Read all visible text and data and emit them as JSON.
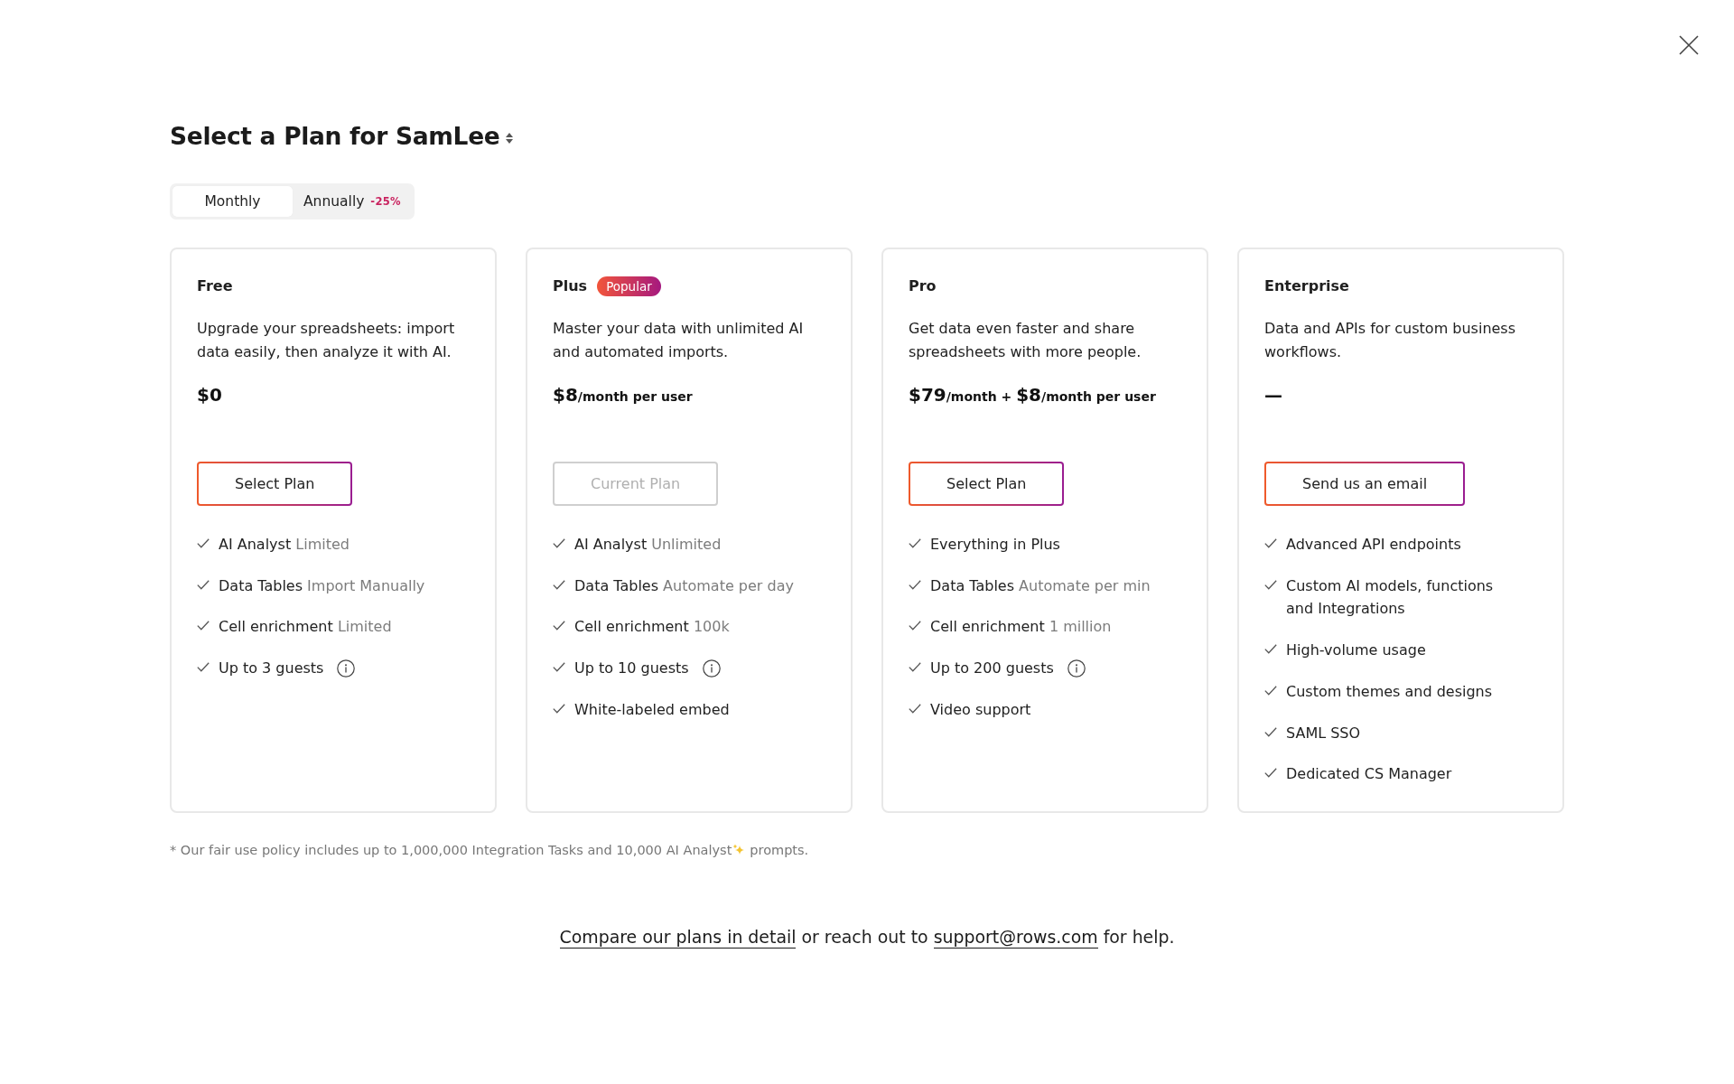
{
  "title": "Select a Plan for SamLee",
  "billing_period": [
    {
      "label": "Monthly",
      "selected": true
    },
    {
      "label": "Annually",
      "selected": false,
      "discount": "-25%"
    }
  ],
  "plans": [
    {
      "name": "Free",
      "description": "Upgrade your spreadsheets: import data easily, then analyze it with AI.",
      "price": [
        {
          "kind": "amount",
          "text": "$0"
        }
      ],
      "button": {
        "label": "Select Plan",
        "disabled": false
      },
      "features": [
        {
          "label": "AI Analyst",
          "detail": "Limited",
          "info": false
        },
        {
          "label": "Data Tables",
          "detail": "Import Manually",
          "info": false
        },
        {
          "label": "Cell enrichment",
          "detail": "Limited",
          "info": false
        },
        {
          "label": "Up to 3 guests",
          "info": true
        }
      ]
    },
    {
      "name": "Plus",
      "badge": "Popular",
      "description": "Master your data with unlimited AI and automated imports.",
      "price": [
        {
          "kind": "amount",
          "text": "$8"
        },
        {
          "kind": "unit",
          "text": "/month per user"
        }
      ],
      "button": {
        "label": "Current Plan",
        "disabled": true
      },
      "features": [
        {
          "label": "AI Analyst",
          "detail": "Unlimited",
          "info": false
        },
        {
          "label": "Data Tables",
          "detail": "Automate per day",
          "info": false
        },
        {
          "label": "Cell enrichment",
          "detail": "100k",
          "info": false
        },
        {
          "label": "Up to 10 guests",
          "info": true
        },
        {
          "label": "White-labeled embed",
          "info": false
        }
      ]
    },
    {
      "name": "Pro",
      "description": "Get data even faster and share spreadsheets with more people.",
      "price": [
        {
          "kind": "amount",
          "text": "$79"
        },
        {
          "kind": "unit",
          "text": "/month + "
        },
        {
          "kind": "amount",
          "text": "$8"
        },
        {
          "kind": "unit",
          "text": "/month per user"
        }
      ],
      "button": {
        "label": "Select Plan",
        "disabled": false
      },
      "features": [
        {
          "label": "Everything in Plus",
          "info": false
        },
        {
          "label": "Data Tables",
          "detail": "Automate per min",
          "info": false
        },
        {
          "label": "Cell enrichment",
          "detail": "1 million",
          "info": false
        },
        {
          "label": "Up to 200 guests",
          "info": true
        },
        {
          "label": "Video support",
          "info": false
        }
      ]
    },
    {
      "name": "Enterprise",
      "description": "Data and APIs for custom business workflows.",
      "price": [
        {
          "kind": "amount",
          "text": "—"
        }
      ],
      "button": {
        "label": "Send us an email",
        "disabled": false
      },
      "features": [
        {
          "label": "Advanced API endpoints",
          "info": false
        },
        {
          "label": "Custom AI models, functions and Integrations",
          "info": false
        },
        {
          "label": "High-volume usage",
          "info": false
        },
        {
          "label": "Custom themes and designs",
          "info": false
        },
        {
          "label": "SAML SSO",
          "info": false
        },
        {
          "label": "Dedicated CS Manager",
          "info": false
        }
      ]
    }
  ],
  "footnote": {
    "text": "* Our fair use policy includes up to 1,000,000 Integration Tasks and 10,000 AI Analyst",
    "after_icon": "prompts."
  },
  "help": [
    {
      "kind": "link",
      "text": "Compare our plans in detail"
    },
    {
      "kind": "text",
      "text": "or reach out to"
    },
    {
      "kind": "link",
      "text": "support@rows.com"
    },
    {
      "kind": "text",
      "text": "for help."
    }
  ]
}
